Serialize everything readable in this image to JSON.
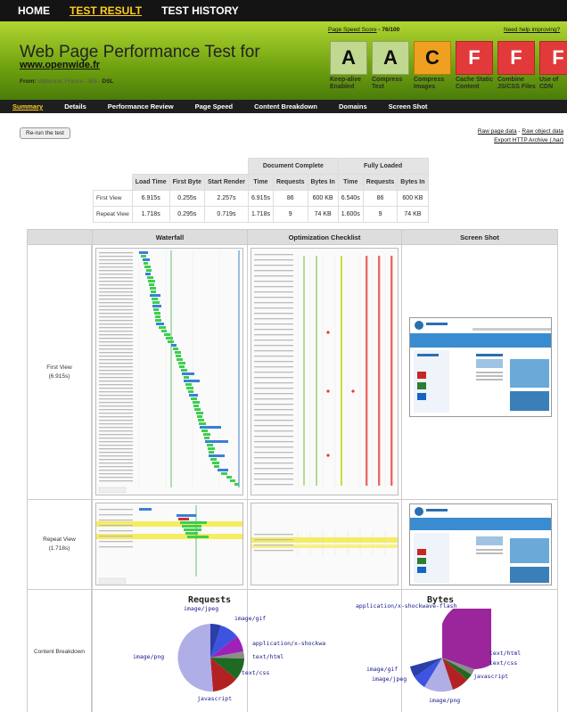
{
  "nav": {
    "home": "HOME",
    "result": "TEST RESULT",
    "history": "TEST HISTORY"
  },
  "header": {
    "title": "Web Page Performance Test for",
    "url": "www.openwide.fr",
    "from_label": "From:",
    "from_location": "Valbonne, France - IE8 -",
    "from_conn": "DSL",
    "score_label": "Page Speed Score",
    "score_value": "- 76/100",
    "help": "Need help improving?"
  },
  "grades": [
    {
      "letter": "A",
      "label": "Keep-alive Enabled",
      "color": "#c0d890"
    },
    {
      "letter": "A",
      "label": "Compress Text",
      "color": "#c0d890"
    },
    {
      "letter": "C",
      "label": "Compress Images",
      "color": "#f0a020"
    },
    {
      "letter": "F",
      "label": "Cache Static Content",
      "color": "#e23a3a"
    },
    {
      "letter": "F",
      "label": "Combine JS/CSS Files",
      "color": "#e23a3a"
    },
    {
      "letter": "F",
      "label": "Use of CDN",
      "color": "#e23a3a"
    }
  ],
  "subnav": [
    "Summary",
    "Details",
    "Performance Review",
    "Page Speed",
    "Content Breakdown",
    "Domains",
    "Screen Shot"
  ],
  "rerun": "Re-run the test",
  "links": {
    "raw_page": "Raw page data",
    "sep": " - ",
    "raw_object": "Raw object data",
    "export": "Export HTTP Archive (.har)"
  },
  "table": {
    "group_doc": "Document Complete",
    "group_full": "Fully Loaded",
    "headers": [
      "Load Time",
      "First Byte",
      "Start Render",
      "Time",
      "Requests",
      "Bytes In",
      "Time",
      "Requests",
      "Bytes In"
    ],
    "rows": [
      {
        "label": "First View",
        "cells": [
          "6.915s",
          "0.255s",
          "2.257s",
          "6.915s",
          "86",
          "600 KB",
          "6.540s",
          "86",
          "600 KB"
        ]
      },
      {
        "label": "Repeat View",
        "cells": [
          "1.718s",
          "0.295s",
          "0.719s",
          "1.718s",
          "9",
          "74 KB",
          "1.600s",
          "9",
          "74 KB"
        ]
      }
    ]
  },
  "grid": {
    "col_waterfall": "Waterfall",
    "col_checklist": "Optimization Checklist",
    "col_screenshot": "Screen Shot",
    "first_view": "First View",
    "first_view_time": "(6.915s)",
    "repeat_view": "Repeat View",
    "repeat_view_time": "(1.718s)",
    "content_breakdown": "Content Breakdown"
  },
  "pies": {
    "requests_title": "Requests",
    "bytes_title": "Bytes",
    "requests_labels": [
      "image/jpeg",
      "image/gif",
      "application/x-shockwa",
      "text/html",
      "text/css",
      "javascript",
      "image/png"
    ],
    "bytes_labels": [
      "application/x-shockwave-flash",
      "text/html",
      "text/css",
      "javascript",
      "image/png",
      "image/jpeg",
      "image/gif"
    ]
  }
}
